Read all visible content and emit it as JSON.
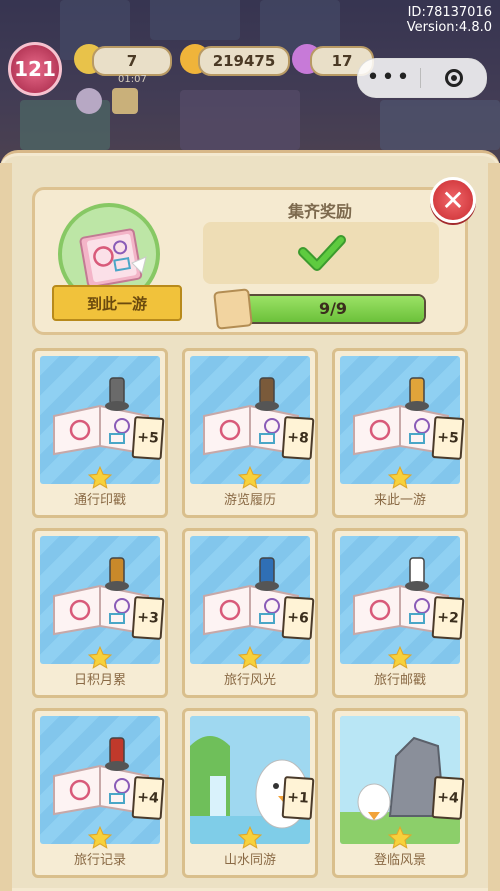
{
  "hud": {
    "level": "121",
    "energy": "7",
    "timer": "01:07",
    "coins": "219475",
    "gems": "17",
    "id_line": "ID:78137016",
    "version_line": "Version:4.8.0",
    "capsule_more": "•••"
  },
  "reward": {
    "title": "集齐奖励",
    "ribbon": "到此一游",
    "progress": "9/9",
    "progress_fraction": 1.0,
    "close_glyph": "✕"
  },
  "cards": [
    {
      "label": "通行印戳",
      "bonus": "+5"
    },
    {
      "label": "游览履历",
      "bonus": "+8"
    },
    {
      "label": "来此一游",
      "bonus": "+5"
    },
    {
      "label": "日积月累",
      "bonus": "+3"
    },
    {
      "label": "旅行风光",
      "bonus": "+6"
    },
    {
      "label": "旅行邮戳",
      "bonus": "+2"
    },
    {
      "label": "旅行记录",
      "bonus": "+4"
    },
    {
      "label": "山水同游",
      "bonus": "+1"
    },
    {
      "label": "登临风景",
      "bonus": "+4"
    }
  ],
  "colors": {
    "panel": "#ece1c4",
    "card_sky": "#8fd0f2",
    "progress_fill": "#6cc13a",
    "close_red": "#d33a3f",
    "ribbon_gold": "#f1c23b"
  }
}
